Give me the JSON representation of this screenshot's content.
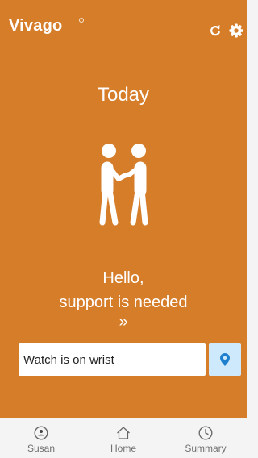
{
  "header": {
    "logo_text": "Vivago"
  },
  "main": {
    "title": "Today",
    "message_line1": "Hello,",
    "message_line2": "support is needed",
    "more_glyph": "»",
    "status_text": "Watch is on wrist"
  },
  "tabs": [
    {
      "label": "Susan",
      "icon": "person-icon"
    },
    {
      "label": "Home",
      "icon": "home-icon"
    },
    {
      "label": "Summary",
      "icon": "clock-icon"
    }
  ],
  "colors": {
    "background": "#d67d2a",
    "location_button": "#cde9fb",
    "location_pin": "#1f7fcf",
    "tabbar": "#f4f4f4"
  }
}
